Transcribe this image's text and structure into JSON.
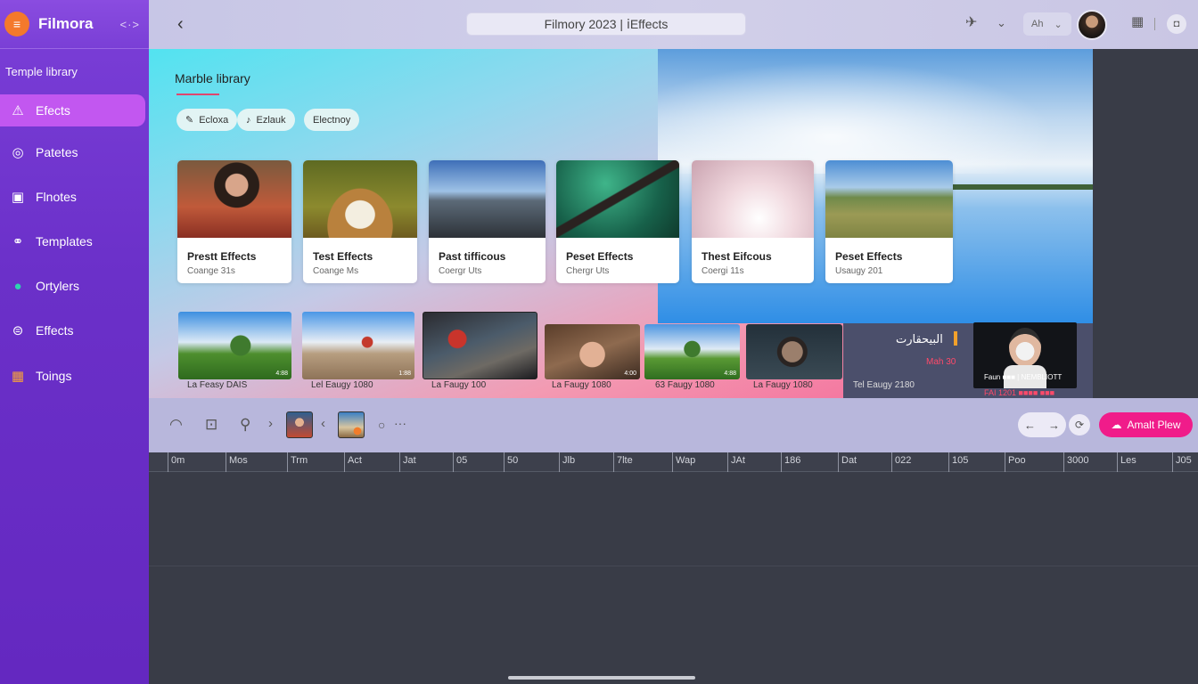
{
  "app": {
    "brand": "Filmora",
    "logo_glyph": "≡",
    "collapse_label": "<·>"
  },
  "sidebar": {
    "section_label": "Temple library",
    "items": [
      {
        "label": "Efects",
        "icon": "sparkle-tent-icon",
        "glyph": "⚠",
        "active": true
      },
      {
        "label": "Patetes",
        "icon": "palette-icon",
        "glyph": "◎",
        "active": false
      },
      {
        "label": "Flnotes",
        "icon": "image-icon",
        "glyph": "▣",
        "active": false
      },
      {
        "label": "Templates",
        "icon": "link-icon",
        "glyph": "⚭",
        "active": false
      },
      {
        "label": "Ortylers",
        "icon": "globe-icon",
        "glyph": "●",
        "active": false
      },
      {
        "label": "Effects",
        "icon": "layers-icon",
        "glyph": "⊜",
        "active": false
      },
      {
        "label": "Toings",
        "icon": "grid-icon",
        "glyph": "▦",
        "active": false
      }
    ]
  },
  "topbar": {
    "back_glyph": "‹",
    "title": "Filmory 2023  |  ⅰEffects",
    "lang_label": "Ah",
    "lang_chevron": "⌄",
    "share_glyph": "✈",
    "chevron_glyph": "⌄",
    "grid_glyph": "▦",
    "round_glyph": "◘"
  },
  "library": {
    "title": "Marble library",
    "chips": [
      {
        "label": "Ecloxa",
        "glyph": "✎"
      },
      {
        "label": "Ezlauk",
        "glyph": "♪"
      },
      {
        "label": "Electnoy",
        "glyph": ""
      }
    ],
    "cards": [
      {
        "title": "Prestt Effects",
        "subtitle": "Coange 31s"
      },
      {
        "title": "Test Effects",
        "subtitle": "Coange Ms"
      },
      {
        "title": "Past tifficous",
        "subtitle": "Coergr Uts"
      },
      {
        "title": "Peset Effects",
        "subtitle": "Chergr Uts"
      },
      {
        "title": "Thest Eifcous",
        "subtitle": "Coergi 11s"
      },
      {
        "title": "Peset Effects",
        "subtitle": "Usaugy 201"
      }
    ],
    "strip": [
      {
        "caption": "La Feasy DAIS",
        "badge": "4:88"
      },
      {
        "caption": "Lel Eaugy 1080",
        "badge": "1:88"
      },
      {
        "caption": "La Faugy 100",
        "badge": ""
      },
      {
        "caption": "La Faugy 1080",
        "badge": "4:00"
      },
      {
        "caption": "63 Faugy 1080",
        "badge": "4:88"
      },
      {
        "caption": "La Faugy 1080",
        "badge": ""
      }
    ],
    "dark_panel": {
      "title": "البيحقارت",
      "subtitle": "Mah 30",
      "caption": "Tel Eaugy 2180"
    },
    "portrait": {
      "caption": "Faun ■■■ | NEMBLIOTT",
      "subtitle": "FAI 1201 ■■■■  ■■■"
    }
  },
  "toolbar": {
    "icons": [
      "◠",
      "⊡",
      "⚲",
      "›",
      "‹",
      "○",
      "···"
    ],
    "nav_prev": "←",
    "nav_next": "→",
    "sync_glyph": "⟳",
    "cta_label": "Amalt Plew",
    "cta_glyph": "☁"
  },
  "timeline": {
    "ticks": [
      "0m",
      "Mos",
      "Trm",
      "Act",
      "Jat",
      "05",
      "50",
      "Jlb",
      "7lte",
      "Wap",
      "JAt",
      "186",
      "Dat",
      "022",
      "105",
      "Poo",
      "3000",
      "Les",
      "J05"
    ]
  },
  "colors": {
    "sidebar": "#6b30c9",
    "sidebar_active": "#c257f0",
    "accent_pink": "#f01c8a",
    "logo_orange": "#f4792c",
    "timeline_bg": "#393c47"
  }
}
